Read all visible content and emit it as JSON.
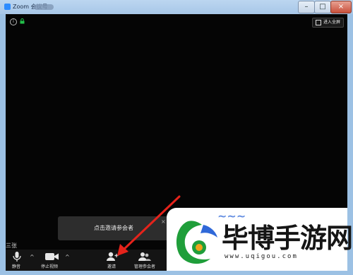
{
  "window": {
    "title": "Zoom 会议号",
    "minimize_label": "–",
    "maximize_label": "□",
    "close_label": "×"
  },
  "video": {
    "fullscreen_label": "进入全屏",
    "info_icon": "info-icon",
    "lock_icon": "lock-icon",
    "gallery_label": "三张"
  },
  "popup": {
    "text": "点击邀请参会者",
    "close_label": "×"
  },
  "toolbar": {
    "items": [
      {
        "label": "静音",
        "icon": "microphone-icon"
      },
      {
        "label": "停止视频",
        "icon": "video-camera-icon"
      },
      {
        "label": "邀请",
        "icon": "invite-person-icon"
      },
      {
        "label": "管理参会者",
        "icon": "participants-icon"
      }
    ],
    "caret": "^"
  },
  "annotation": {
    "arrow_color": "#e5231b"
  },
  "watermark": {
    "brand": "毕博手游网",
    "url": "www.uqigou.com",
    "logo_colors": [
      "#1f9e3a",
      "#2f68d8",
      "#f0a21b"
    ]
  }
}
